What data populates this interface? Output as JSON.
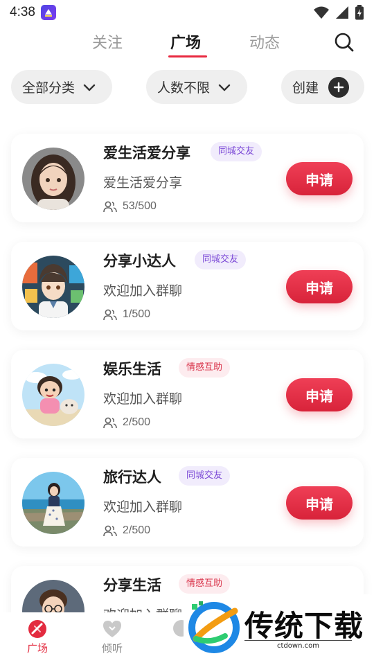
{
  "status_bar": {
    "time": "4:38"
  },
  "top_tabs": [
    {
      "label": "关注",
      "active": false
    },
    {
      "label": "广场",
      "active": true
    },
    {
      "label": "动态",
      "active": false
    }
  ],
  "filters": {
    "category": "全部分类",
    "members": "人数不限",
    "create": "创建"
  },
  "groups": [
    {
      "title": "爱生活爱分享",
      "tag": "同城交友",
      "tag_color": "purple",
      "desc": "爱生活爱分享",
      "count": "53/500",
      "apply": "申请",
      "avatar": "girl-portrait"
    },
    {
      "title": "分享小达人",
      "tag": "同城交友",
      "tag_color": "purple",
      "desc": "欢迎加入群聊",
      "count": "1/500",
      "apply": "申请",
      "avatar": "boy-anime"
    },
    {
      "title": "娱乐生活",
      "tag": "情感互助",
      "tag_color": "red",
      "desc": "欢迎加入群聊",
      "count": "2/500",
      "apply": "申请",
      "avatar": "kid-cartoon"
    },
    {
      "title": "旅行达人",
      "tag": "同城交友",
      "tag_color": "purple",
      "desc": "欢迎加入群聊",
      "count": "2/500",
      "apply": "申请",
      "avatar": "seaside-girl"
    },
    {
      "title": "分享生活",
      "tag": "情感互助",
      "tag_color": "red",
      "desc": "欢迎加入群聊",
      "count": "",
      "apply": "",
      "avatar": "glasses-boy"
    }
  ],
  "bottom_nav": [
    {
      "label": "广场",
      "icon": "plaza-icon",
      "active": true
    },
    {
      "label": "倾听",
      "icon": "heart-icon",
      "active": false
    },
    {
      "label": "",
      "icon": "chat-icon",
      "active": false
    }
  ],
  "watermark": {
    "text": "传统下载",
    "url": "ctdown.com"
  },
  "colors": {
    "accent": "#e32b3f",
    "tag_purple": "#7a47d6",
    "tag_red": "#d9334a"
  }
}
